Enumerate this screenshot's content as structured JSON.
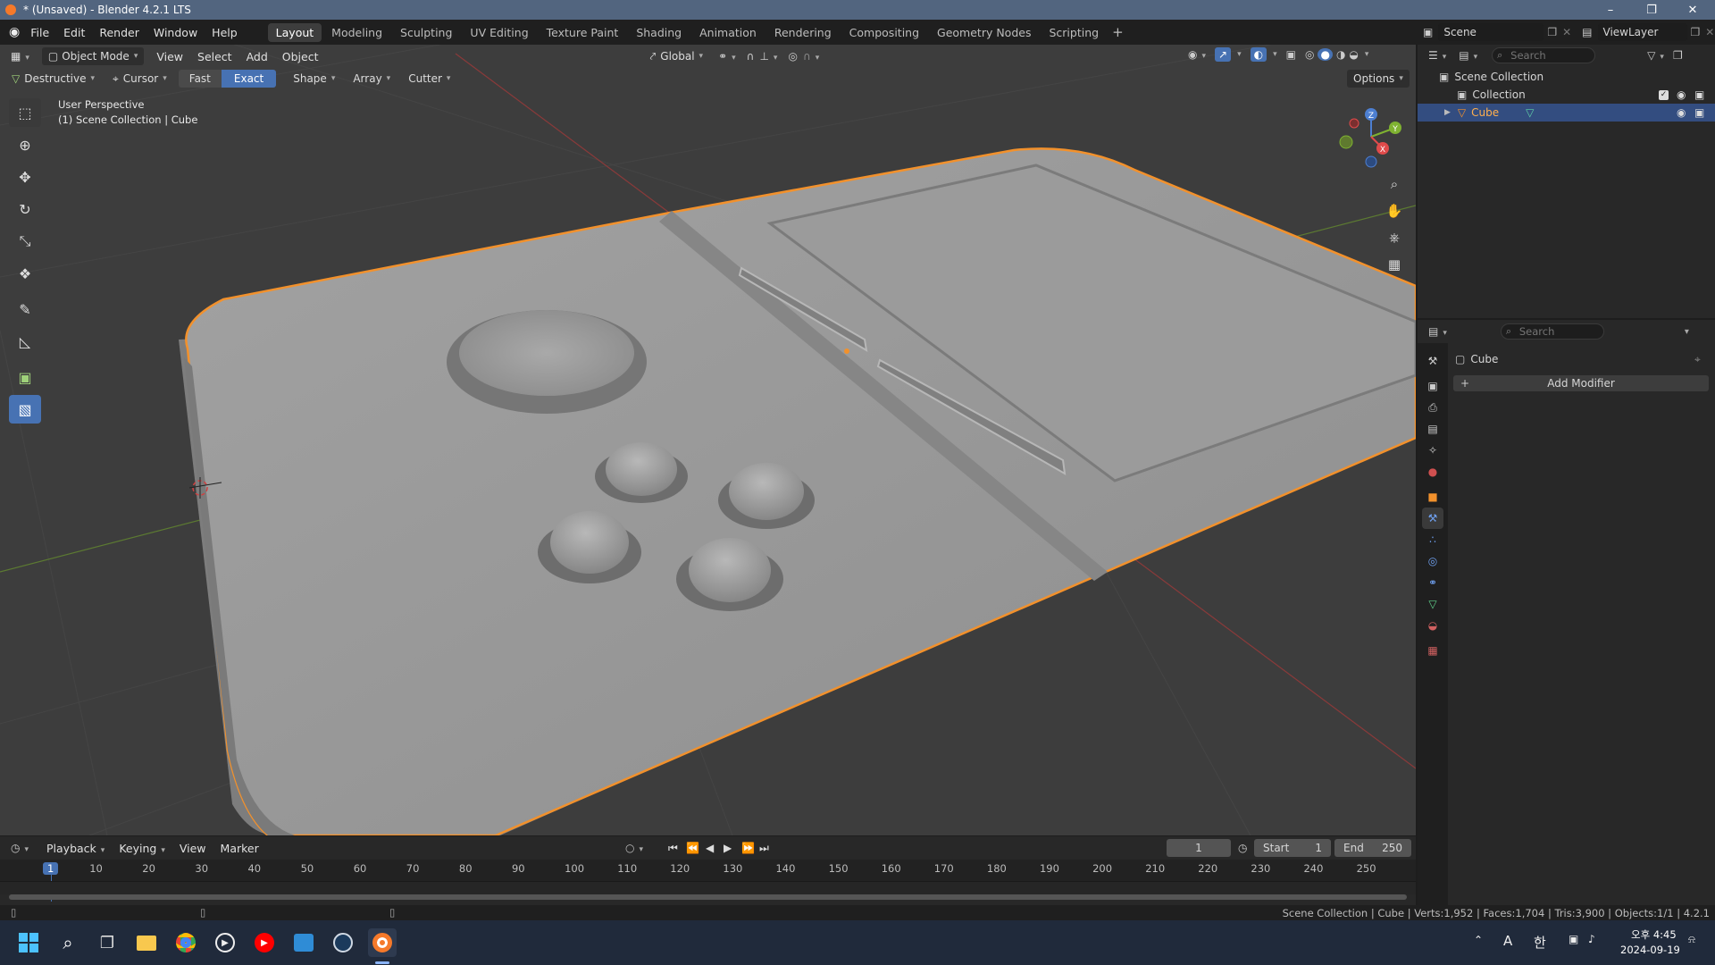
{
  "window": {
    "title": "* (Unsaved) - Blender 4.2.1 LTS"
  },
  "menu": {
    "items": [
      "File",
      "Edit",
      "Render",
      "Window",
      "Help"
    ]
  },
  "workspaces": {
    "tabs": [
      "Layout",
      "Modeling",
      "Sculpting",
      "UV Editing",
      "Texture Paint",
      "Shading",
      "Animation",
      "Rendering",
      "Compositing",
      "Geometry Nodes",
      "Scripting"
    ],
    "active": "Layout"
  },
  "scene": {
    "name": "Scene",
    "view_layer": "ViewLayer"
  },
  "viewport_header": {
    "mode": "Object Mode",
    "menus": [
      "View",
      "Select",
      "Add",
      "Object"
    ],
    "transform_orientation": "Global"
  },
  "tool_header": {
    "destructive": "Destructive",
    "cursor": "Cursor",
    "fast": "Fast",
    "exact": "Exact",
    "shape": "Shape",
    "array": "Array",
    "cutter": "Cutter",
    "options": "Options"
  },
  "viewport_info": {
    "perspective": "User Perspective",
    "collection": "(1) Scene Collection | Cube"
  },
  "gizmo": {
    "x": "X",
    "y": "Y",
    "z": "Z"
  },
  "outliner": {
    "search_placeholder": "Search",
    "rows": [
      "Scene Collection",
      "Collection",
      "Cube"
    ]
  },
  "properties": {
    "search_placeholder": "Search",
    "object_name": "Cube",
    "add_modifier": "Add Modifier"
  },
  "timeline": {
    "menus": [
      "Playback",
      "Keying",
      "View",
      "Marker"
    ],
    "current_frame": "1",
    "start_label": "Start",
    "start": "1",
    "end_label": "End",
    "end": "250",
    "ruler": [
      "1",
      "10",
      "20",
      "30",
      "40",
      "50",
      "60",
      "70",
      "80",
      "90",
      "100",
      "110",
      "120",
      "130",
      "140",
      "150",
      "160",
      "170",
      "180",
      "190",
      "200",
      "210",
      "220",
      "230",
      "240",
      "250"
    ]
  },
  "statusbar": {
    "text": "Scene Collection | Cube | Verts:1,952 | Faces:1,704 | Tris:3,900 | Objects:1/1 | 4.2.1"
  },
  "taskbar": {
    "ime": "A",
    "ime2": "한",
    "time": "오후 4:45",
    "date": "2024-09-19"
  },
  "colors": {
    "accent": "#4772b3",
    "selection": "#f2912c",
    "title_bar": "#52657f"
  }
}
